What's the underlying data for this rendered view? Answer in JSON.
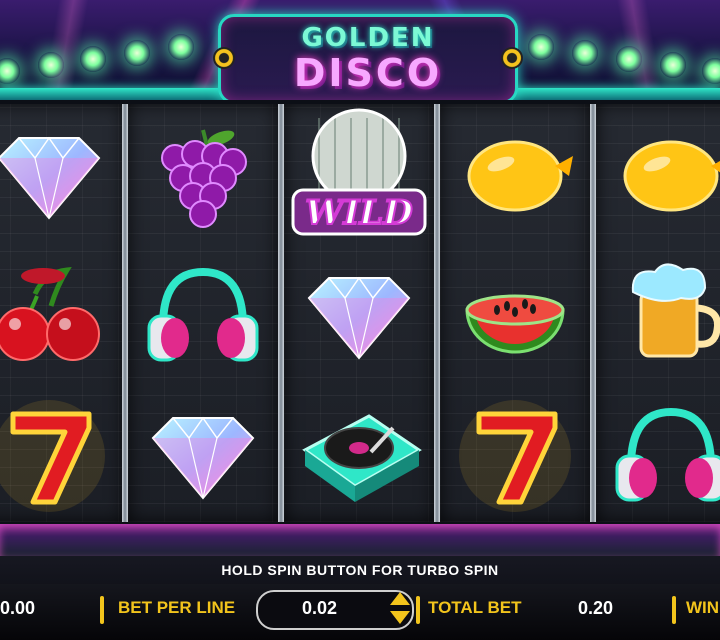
{
  "game": {
    "title_line1": "GOLDEN",
    "title_line2": "DISCO"
  },
  "reels": [
    [
      "diamond",
      "cherries",
      "seven"
    ],
    [
      "grapes",
      "headphones",
      "diamond"
    ],
    [
      "wild",
      "diamond",
      "turntable"
    ],
    [
      "lemon",
      "watermelon",
      "seven"
    ],
    [
      "lemon",
      "beer",
      "headphones"
    ]
  ],
  "wild_label": "WILD",
  "hint_text": "HOLD SPIN BUTTON FOR TURBO SPIN",
  "bottom_bar": {
    "balance_value": "0.00",
    "bet_per_line_label": "BET PER LINE",
    "bet_per_line_value": "0.02",
    "total_bet_label": "TOTAL BET",
    "total_bet_value": "0.20",
    "win_label": "WIN"
  },
  "colors": {
    "accent_gold": "#f2c41c",
    "teal": "#2fe7c8",
    "magenta": "#ff3fd0"
  }
}
